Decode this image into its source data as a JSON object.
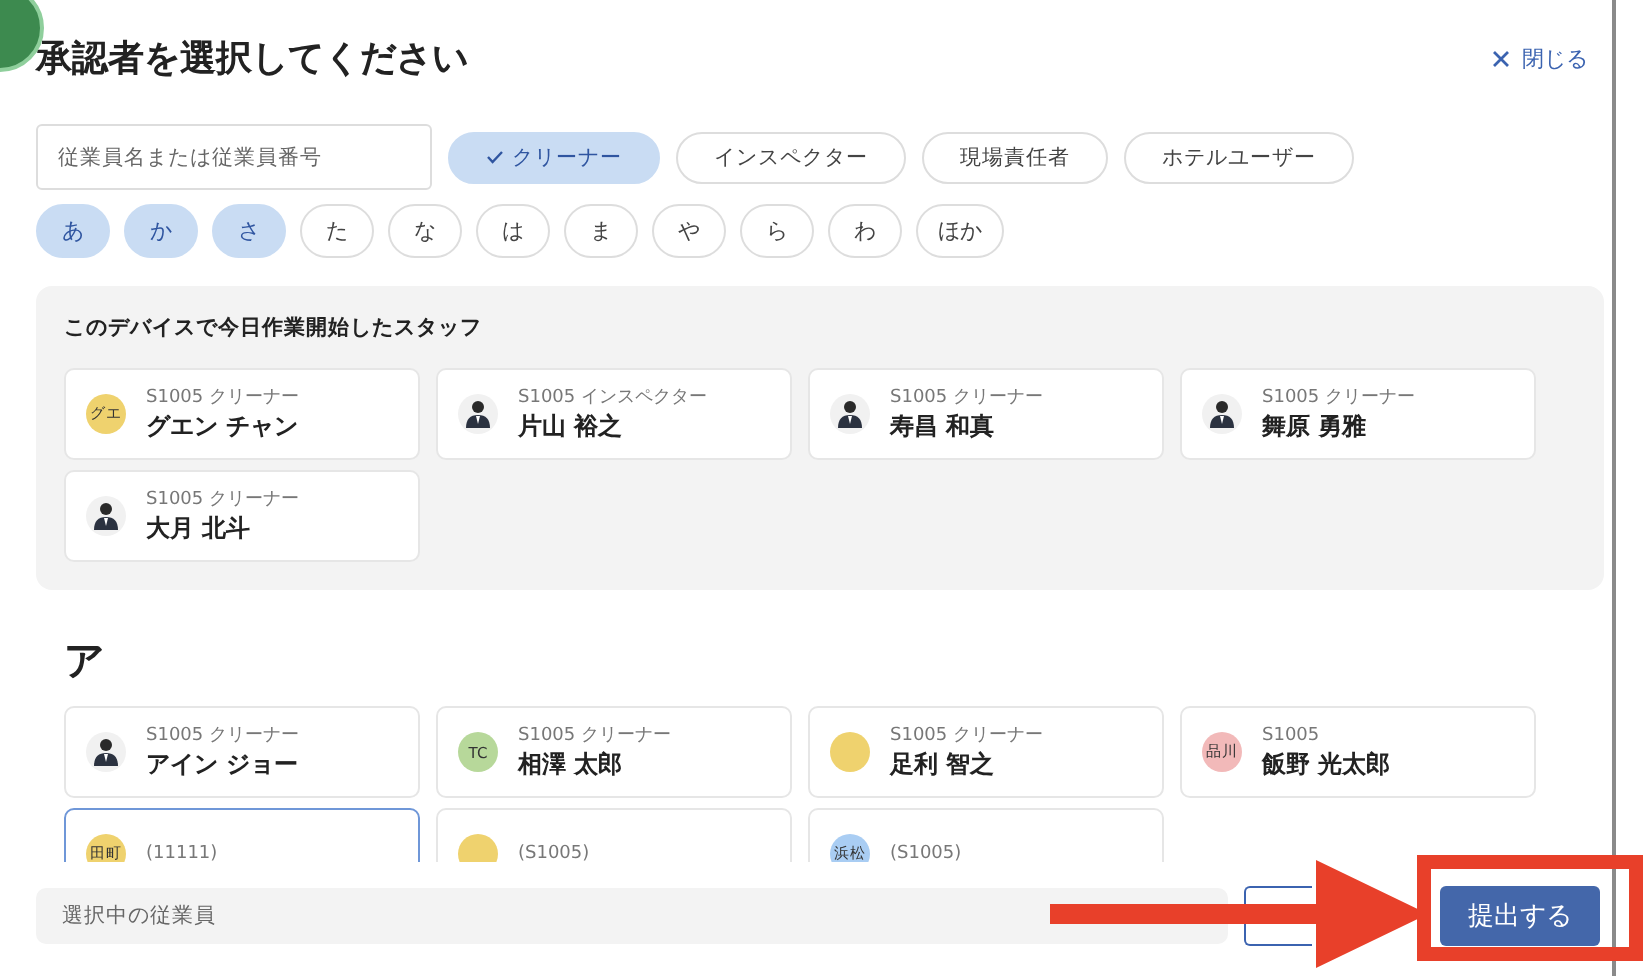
{
  "title": "承認者を選択してください",
  "close_label": "閉じる",
  "search": {
    "placeholder": "従業員名または従業員番号"
  },
  "roles": [
    {
      "label": "クリーナー",
      "selected": true
    },
    {
      "label": "インスペクター",
      "selected": false
    },
    {
      "label": "現場責任者",
      "selected": false
    },
    {
      "label": "ホテルユーザー",
      "selected": false
    }
  ],
  "kana": [
    {
      "label": "あ",
      "selected": true
    },
    {
      "label": "か",
      "selected": true
    },
    {
      "label": "さ",
      "selected": true
    },
    {
      "label": "た",
      "selected": false
    },
    {
      "label": "な",
      "selected": false
    },
    {
      "label": "は",
      "selected": false
    },
    {
      "label": "ま",
      "selected": false
    },
    {
      "label": "や",
      "selected": false
    },
    {
      "label": "ら",
      "selected": false
    },
    {
      "label": "わ",
      "selected": false
    },
    {
      "label": "ほか",
      "selected": false
    }
  ],
  "recent": {
    "heading": "このデバイスで今日作業開始したスタッフ",
    "staff": [
      {
        "avatar": {
          "kind": "initials",
          "text": "グエ",
          "color": "#efd26e"
        },
        "meta": "S1005 クリーナー",
        "name": "グエン チャン",
        "selected": false
      },
      {
        "avatar": {
          "kind": "photo"
        },
        "meta": "S1005 インスペクター",
        "name": "片山 裕之",
        "selected": false
      },
      {
        "avatar": {
          "kind": "photo"
        },
        "meta": "S1005 クリーナー",
        "name": "寿昌 和真",
        "selected": false
      },
      {
        "avatar": {
          "kind": "photo"
        },
        "meta": "S1005 クリーナー",
        "name": "舞原 勇雅",
        "selected": false
      },
      {
        "avatar": {
          "kind": "photo"
        },
        "meta": "S1005 クリーナー",
        "name": "大月 北斗",
        "selected": false
      }
    ]
  },
  "sections": [
    {
      "heading": "ア",
      "staff": [
        {
          "avatar": {
            "kind": "photo"
          },
          "meta": "S1005 クリーナー",
          "name": "アイン ジョー",
          "selected": false
        },
        {
          "avatar": {
            "kind": "initials",
            "text": "TC",
            "color": "#b7d89a"
          },
          "meta": "S1005 クリーナー",
          "name": "相澤 太郎",
          "selected": false
        },
        {
          "avatar": {
            "kind": "initials",
            "color": "#efd26e"
          },
          "meta": "S1005 クリーナー",
          "name": "足利 智之",
          "selected": false
        },
        {
          "avatar": {
            "kind": "initials",
            "text": "品川",
            "color": "#f2b9b9"
          },
          "meta": "S1005",
          "name": "飯野 光太郎",
          "selected": false
        },
        {
          "avatar": {
            "kind": "initials",
            "text": "田町",
            "color": "#efd26e"
          },
          "meta": "(11111)",
          "selected": true
        },
        {
          "avatar": {
            "kind": "initials",
            "color": "#efd26e"
          },
          "meta": "(S1005)",
          "selected": false
        },
        {
          "avatar": {
            "kind": "initials",
            "text": "浜松",
            "color": "#a9cdf3"
          },
          "meta": "(S1005)",
          "selected": false
        }
      ]
    }
  ],
  "footer": {
    "selected_placeholder": "選択中の従業員",
    "submit": "提出する"
  }
}
